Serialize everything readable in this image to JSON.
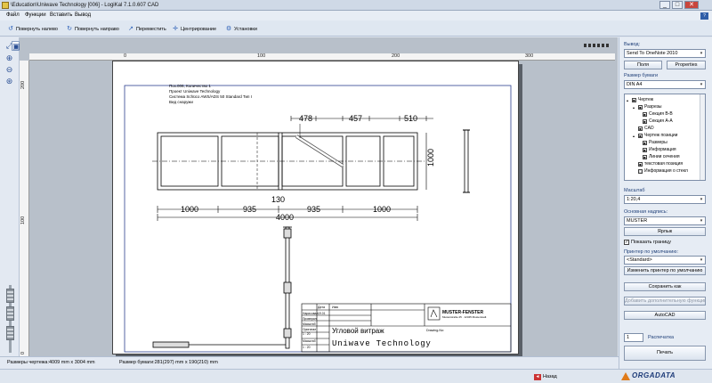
{
  "window": {
    "title": "\\Education\\Uniwave Technology [006] - LogiKal 7.1.0.607 CAD",
    "controls": [
      "_",
      "□",
      "✕"
    ]
  },
  "menu": {
    "items": [
      "Файл",
      "Функции",
      "Вставить",
      "Вывод"
    ],
    "help": "?"
  },
  "toolbar": {
    "rotate_left": "Повернуть налево",
    "rotate_right": "Повернуть направо",
    "move": "Переместить",
    "center": "Центрирование",
    "settings": "Установки"
  },
  "rulers": {
    "h_ticks": [
      "0",
      "100",
      "200",
      "300"
    ],
    "v_ticks": [
      "200",
      "100",
      "0"
    ]
  },
  "drawing": {
    "position_info": [
      "Поз.006, Количество 1",
      "Проект Uniwave Technology",
      "Система Schüco AWS/ADS 50 Standard Тип I",
      "Вид снаружи"
    ],
    "top_dims": [
      "478",
      "457",
      "510"
    ],
    "right_dim": "1000",
    "mid_dim": "130",
    "bottom_dims": [
      "1000",
      "935",
      "935",
      "1000"
    ],
    "total_dim": "4000",
    "title_table_headers": [
      "Дата",
      "Имя"
    ],
    "title_table_rows": [
      "Нарисовал",
      "Проверил",
      "Масштаб",
      "Оригинал",
      "Масштаб",
      "Размер"
    ],
    "drawn_date": "19.01",
    "scale_a": "1 : 20",
    "scale_b": "1 : 20",
    "company_logo_text": "MUSTER-FENSTER",
    "company_sub": "Musterstraße 25 · 12345 Musterstadt",
    "drawing_no_label": "Drawing-No:",
    "drawing_title": "Угловой витраж",
    "project_name": "Uniwave Technology"
  },
  "right_panel": {
    "output_label": "Вывод:",
    "output_value": "Send To OneNote 2010",
    "fields_button": "Поля",
    "properties_button": "Properties",
    "paper_label": "Размер бумаги",
    "paper_value": "DIN A4",
    "tree": [
      {
        "label": "Чертеж",
        "indent": 0,
        "check": "■",
        "twist": "▴"
      },
      {
        "label": "Разрезы",
        "indent": 1,
        "check": "■",
        "twist": "▴"
      },
      {
        "label": "Секция B-B",
        "indent": 2,
        "check": "■",
        "twist": ""
      },
      {
        "label": "Секция A-A",
        "indent": 2,
        "check": "■",
        "twist": ""
      },
      {
        "label": "CAD",
        "indent": 1,
        "check": "■",
        "twist": ""
      },
      {
        "label": "Чертеж позиции",
        "indent": 1,
        "check": "■",
        "twist": "▴"
      },
      {
        "label": "Размеры",
        "indent": 2,
        "check": "■",
        "twist": ""
      },
      {
        "label": "Информация",
        "indent": 2,
        "check": "■",
        "twist": ""
      },
      {
        "label": "Линии сечения",
        "indent": 2,
        "check": "■",
        "twist": ""
      },
      {
        "label": "текстовая позиция",
        "indent": 1,
        "check": "■",
        "twist": ""
      },
      {
        "label": "Информация о стекл",
        "indent": 1,
        "check": "□",
        "twist": ""
      }
    ],
    "scale_label": "Масштаб",
    "scale_value": "1:20,4",
    "titleblock_label": "Основная надпись:",
    "titleblock_value": "MUSTER",
    "label_button": "Ярлык",
    "show_border_label": "Показать границу",
    "show_border_checked": "✓",
    "default_printer_label": "Принтер по умолчанию:",
    "default_printer_value": "<Standard>",
    "change_printer_button": "Изменить принтер по умолчанию",
    "save_as_button": "Сохранить как",
    "extra_function_button": "Добавить дополнительную функцию",
    "autocad_button": "AutoCAD",
    "copies_value": "1",
    "copies_label": "Распечатка",
    "print_button": "Печать"
  },
  "status": {
    "drawing_size": "Размеры чертежа:4009 mm x 3004 mm",
    "paper_size": "Размер бумаги:281(297) mm x 190(210) mm"
  },
  "bottom": {
    "exit_label": "Назад",
    "brand": "ORGADATA"
  }
}
